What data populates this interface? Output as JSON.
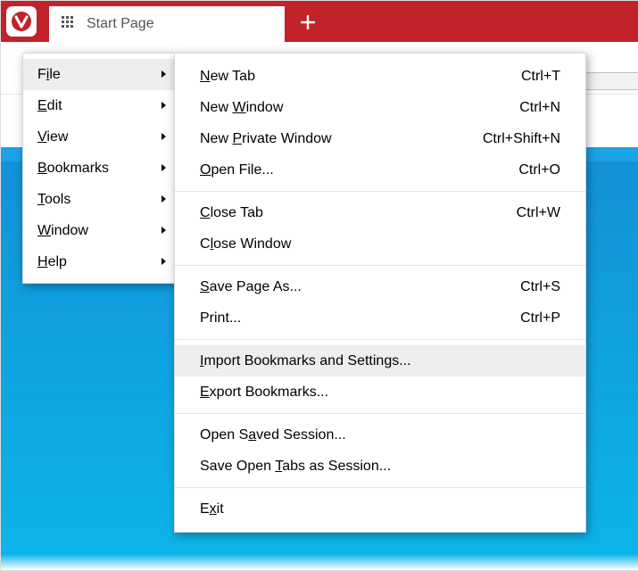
{
  "titlebar": {
    "tab_title": "Start Page"
  },
  "main_menu": {
    "items": [
      {
        "pre": "F",
        "u": "i",
        "post": "le",
        "active": true
      },
      {
        "pre": "",
        "u": "E",
        "post": "dit"
      },
      {
        "pre": "",
        "u": "V",
        "post": "iew"
      },
      {
        "pre": "",
        "u": "B",
        "post": "ookmarks"
      },
      {
        "pre": "",
        "u": "T",
        "post": "ools"
      },
      {
        "pre": "",
        "u": "W",
        "post": "indow"
      },
      {
        "pre": "",
        "u": "H",
        "post": "elp"
      }
    ]
  },
  "file_menu": {
    "groups": [
      [
        {
          "pre": "",
          "u": "N",
          "post": "ew Tab",
          "shortcut": "Ctrl+T"
        },
        {
          "pre": "New ",
          "u": "W",
          "post": "indow",
          "shortcut": "Ctrl+N"
        },
        {
          "pre": "New ",
          "u": "P",
          "post": "rivate Window",
          "shortcut": "Ctrl+Shift+N"
        },
        {
          "pre": "",
          "u": "O",
          "post": "pen File...",
          "shortcut": "Ctrl+O"
        }
      ],
      [
        {
          "pre": "",
          "u": "C",
          "post": "lose Tab",
          "shortcut": "Ctrl+W"
        },
        {
          "pre": "C",
          "u": "l",
          "post": "ose Window",
          "shortcut": ""
        }
      ],
      [
        {
          "pre": "",
          "u": "S",
          "post": "ave Page As...",
          "shortcut": "Ctrl+S"
        },
        {
          "pre": "Print...",
          "u": "",
          "post": "",
          "shortcut": "Ctrl+P"
        }
      ],
      [
        {
          "pre": "",
          "u": "I",
          "post": "mport Bookmarks and Settings...",
          "shortcut": "",
          "hover": true
        },
        {
          "pre": "",
          "u": "E",
          "post": "xport Bookmarks...",
          "shortcut": ""
        }
      ],
      [
        {
          "pre": "Open S",
          "u": "a",
          "post": "ved Session...",
          "shortcut": ""
        },
        {
          "pre": "Save Open ",
          "u": "T",
          "post": "abs as Session...",
          "shortcut": ""
        }
      ],
      [
        {
          "pre": "E",
          "u": "x",
          "post": "it",
          "shortcut": ""
        }
      ]
    ]
  }
}
